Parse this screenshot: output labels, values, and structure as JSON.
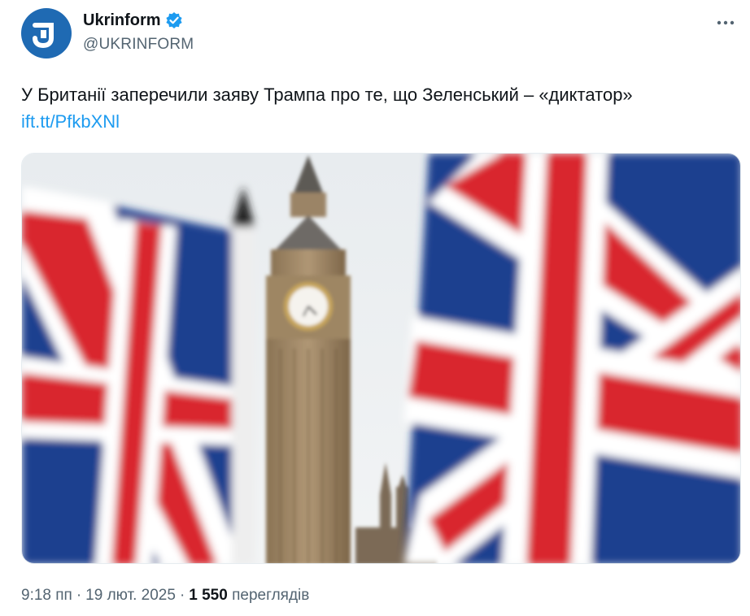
{
  "author": {
    "name": "Ukrinform",
    "handle": "@UKRINFORM",
    "avatar_icon": "ukrinform-logo-icon",
    "avatar_color": "#1f6ab3",
    "verified_color": "#1d9bf0"
  },
  "tweet": {
    "text": "У Британії заперечили заяву Трампа про те, що Зеленський – «диктатор»",
    "link": "ift.tt/PfkbXNl"
  },
  "media": {
    "alt": "photo"
  },
  "meta": {
    "time": "9:18 пп",
    "separator": "·",
    "date": "19 лют. 2025",
    "views_count": "1 550",
    "views_label": "переглядів"
  },
  "colors": {
    "text": "#0f1419",
    "secondary": "#536471",
    "link": "#1d9bf0"
  }
}
